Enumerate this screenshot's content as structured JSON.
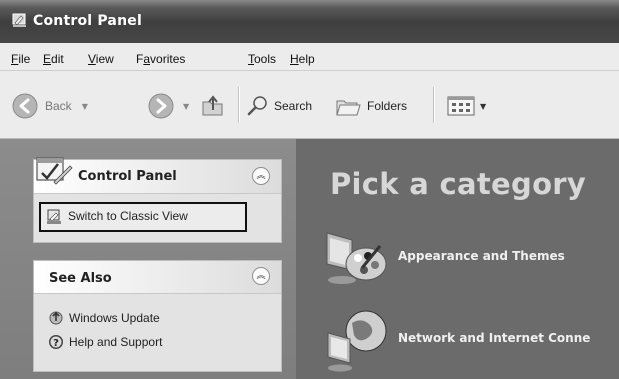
{
  "window": {
    "title": "Control Panel"
  },
  "menu": [
    {
      "label": "File",
      "accel": "F",
      "rest": "ile"
    },
    {
      "label": "Edit",
      "accel": "E",
      "rest": "dit"
    },
    {
      "label": "View",
      "accel": "V",
      "rest": "iew"
    },
    {
      "label": "Favorites",
      "pre": "F",
      "accel": "a",
      "rest": "vorites"
    },
    {
      "label": "Tools",
      "accel": "T",
      "rest": "ools"
    },
    {
      "label": "Help",
      "accel": "H",
      "rest": "elp"
    }
  ],
  "toolbar": {
    "back_label": "Back",
    "search_label": "Search",
    "folders_label": "Folders"
  },
  "left_pane": {
    "control_panel": {
      "title": "Control Panel",
      "switch_label": "Switch to Classic View"
    },
    "see_also": {
      "title": "See Also",
      "links": [
        {
          "label": "Windows Update",
          "icon": "windows-update-icon"
        },
        {
          "label": "Help and Support",
          "icon": "help-icon"
        }
      ]
    }
  },
  "main": {
    "heading": "Pick a category",
    "categories": [
      {
        "label": "Appearance and Themes",
        "icon": "appearance-themes-icon"
      },
      {
        "label": "Network and Internet Conne",
        "icon": "network-internet-icon"
      }
    ]
  },
  "colors": {
    "title_bar": "#3f3f3f",
    "right_pane_bg": "#6b6b6b",
    "left_pane_bg": "#858585"
  }
}
